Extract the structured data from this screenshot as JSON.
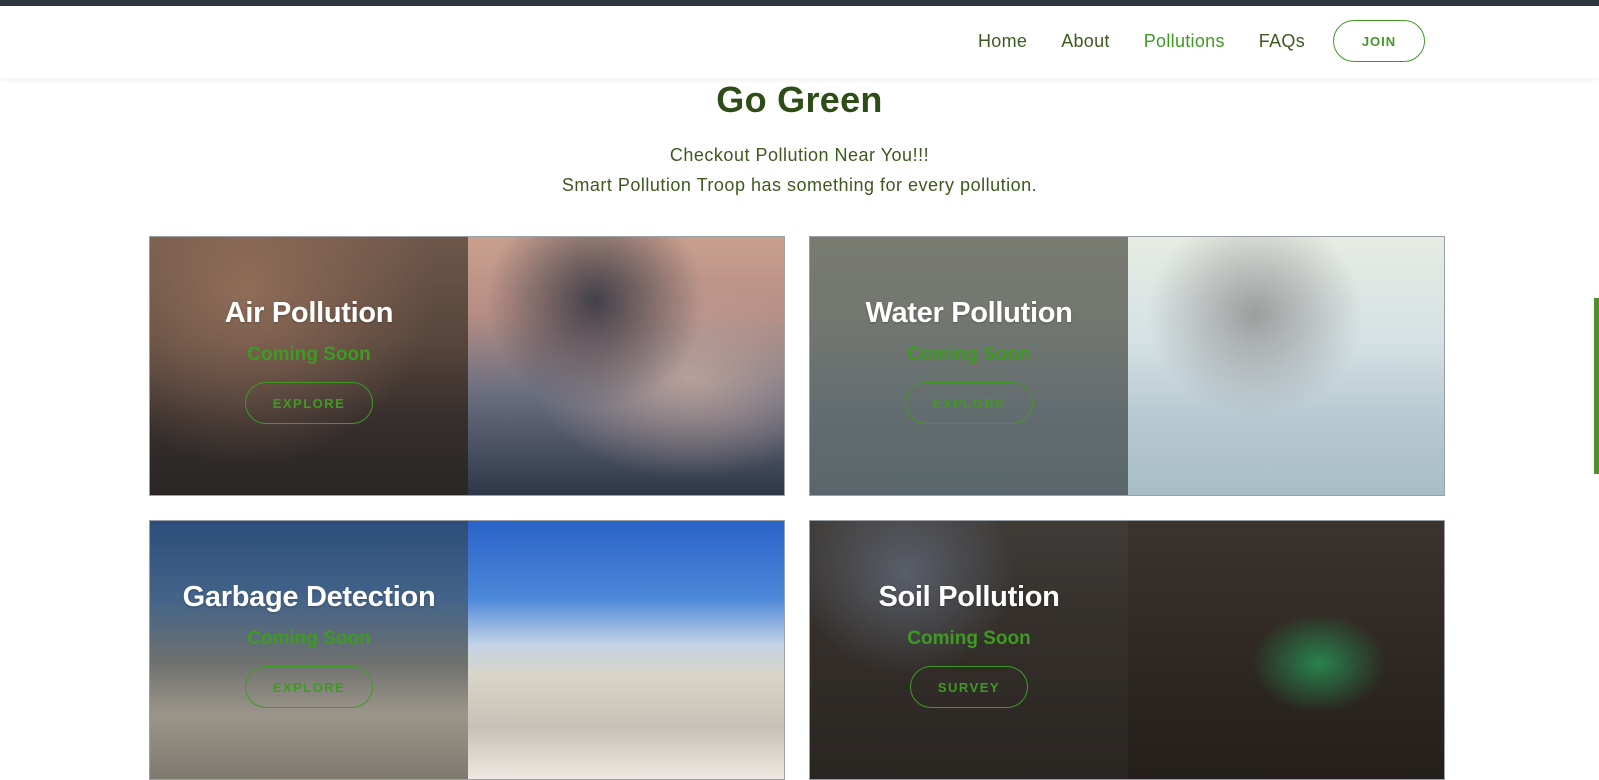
{
  "nav": {
    "items": [
      {
        "label": "Home"
      },
      {
        "label": "About"
      },
      {
        "label": "Pollutions",
        "active": true
      },
      {
        "label": "FAQs"
      }
    ],
    "join_label": "JOIN"
  },
  "hero": {
    "title": "Go Green",
    "line1": "Checkout Pollution Near You!!!",
    "line2": "Smart Pollution Troop has something for every pollution."
  },
  "cards": [
    {
      "title": "Air Pollution",
      "status": "Coming Soon",
      "button": "EXPLORE"
    },
    {
      "title": "Water Pollution",
      "status": "Coming Soon",
      "button": "EXPLORE"
    },
    {
      "title": "Garbage Detection",
      "status": "Coming Soon",
      "button": "EXPLORE"
    },
    {
      "title": "Soil Pollution",
      "status": "Coming Soon",
      "button": "SURVEY"
    }
  ],
  "colors": {
    "accent_green": "#3f9a24",
    "dark_green": "#2e4d16",
    "text_green": "#3c5a1e"
  }
}
